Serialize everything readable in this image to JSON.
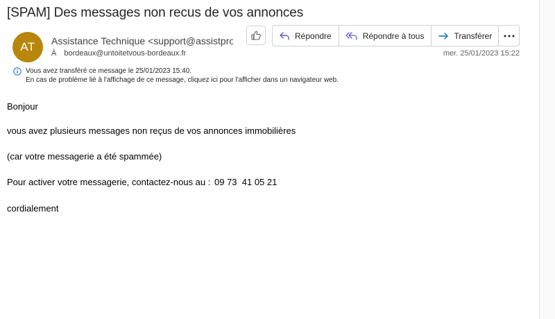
{
  "email": {
    "subject": "[SPAM] Des messages non recus de vos annonces",
    "avatar_initials": "AT",
    "avatar_color": "#b8860b",
    "sender": "Assistance Technique <support@assistpro",
    "to_label": "À",
    "recipient": "bordeaux@untoitetvous-bordeaux.fr",
    "date": "mer. 25/01/2023 15:22",
    "info_line1": "Vous avez transféré ce message le 25/01/2023 15:40.",
    "info_line2": "En cas de problème lié à l'affichage de ce message, cliquez ici pour l'afficher dans un navigateur web.",
    "body": {
      "greeting": "Bonjour",
      "line1": "vous avez  plusieurs messages non reçus de vos annonces immobilières",
      "line2": "(car votre messagerie a été spammée)",
      "line3_prefix": "Pour activer votre messagerie, contactez-nous au :",
      "phone": "09 73  41 05 21",
      "closing": "cordialement"
    }
  },
  "toolbar": {
    "like_icon": "thumbs-up-icon",
    "reply_label": "Répondre",
    "reply_all_label": "Répondre à tous",
    "forward_label": "Transférer",
    "more_icon": "more-options-icon",
    "accent_color": "#5b5fc7",
    "forward_color": "#0f6cbd"
  }
}
